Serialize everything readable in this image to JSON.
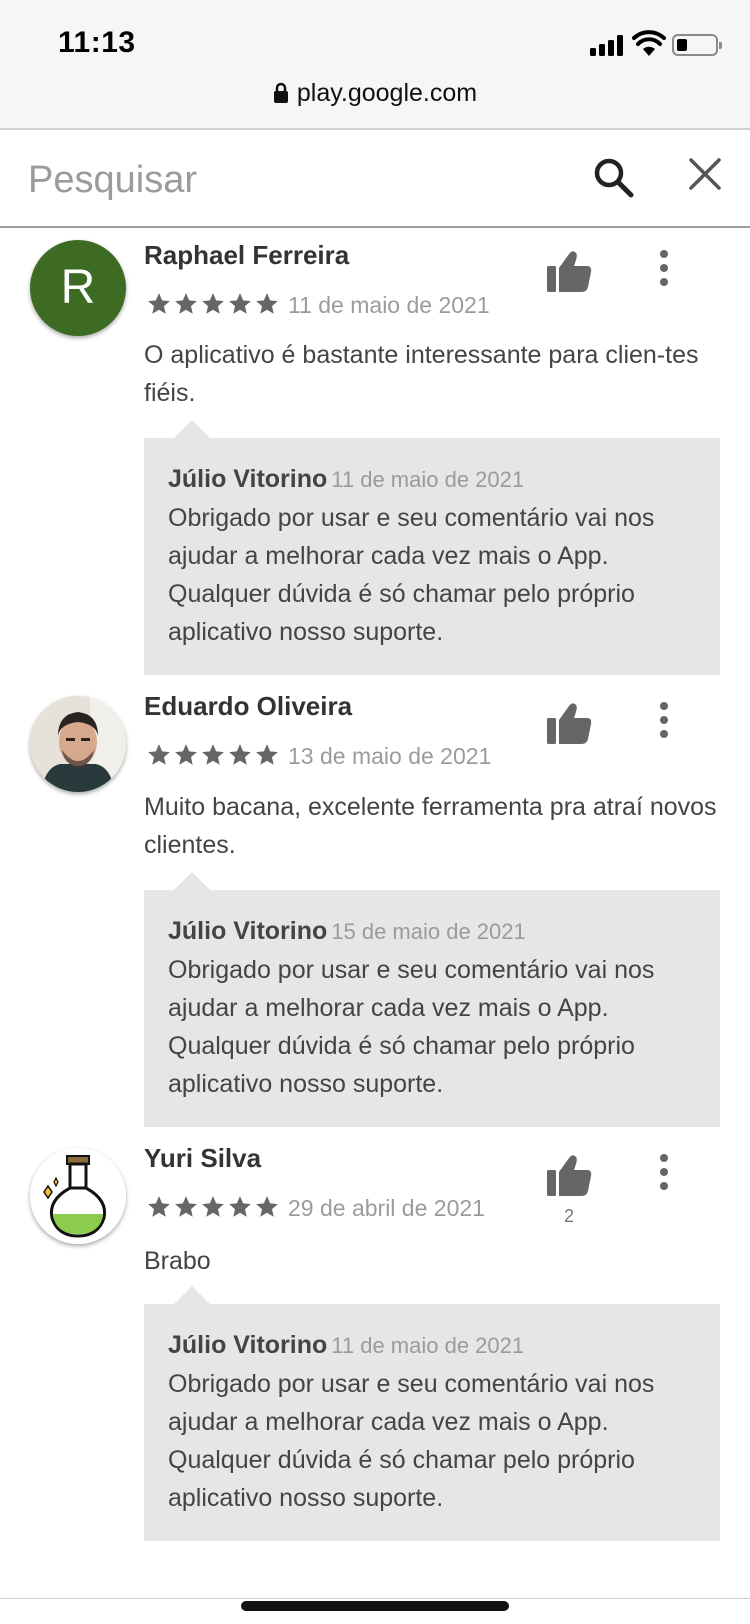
{
  "status_bar": {
    "time": "11:13",
    "url": "play.google.com"
  },
  "search": {
    "placeholder": "Pesquisar",
    "value": ""
  },
  "reviews": [
    {
      "author": "Raphael Ferreira",
      "avatar_letter": "R",
      "avatar_color": "#3e6b23",
      "rating": 5,
      "date": "11 de maio de 2021",
      "text": "O aplicativo é bastante interessante para clien-tes fiéis.",
      "likes": "",
      "reply": {
        "author": "Júlio Vitorino",
        "date": "11 de maio de 2021",
        "text": "Obrigado por usar e seu comentário vai nos ajudar a melhorar cada vez mais o App. Qualquer dúvida é só chamar pelo próprio aplicativo nosso suporte."
      }
    },
    {
      "author": "Eduardo Oliveira",
      "rating": 5,
      "date": "13 de maio de 2021",
      "text": "Muito bacana, excelente ferramenta pra atraí novos clientes.",
      "likes": "",
      "reply": {
        "author": "Júlio Vitorino",
        "date": "15 de maio de 2021",
        "text": "Obrigado por usar e seu comentário vai nos ajudar a melhorar cada vez mais o App. Qualquer dúvida é só chamar pelo próprio aplicativo nosso suporte."
      }
    },
    {
      "author": "Yuri Silva",
      "rating": 5,
      "date": "29 de abril de 2021",
      "text": "Brabo",
      "likes": "2",
      "reply": {
        "author": "Júlio Vitorino",
        "date": "11 de maio de 2021",
        "text": "Obrigado por usar e seu comentário vai nos ajudar a melhorar cada vez mais o App. Qualquer dúvida é só chamar pelo próprio aplicativo nosso suporte."
      }
    }
  ],
  "icons": {
    "search": "search-icon",
    "close": "close-icon",
    "like": "thumbs-up-icon",
    "more": "more-vert-icon",
    "star": "star-icon",
    "lock": "lock-icon"
  },
  "colors": {
    "star": "#666666",
    "reply_bg": "#e6e6e6",
    "secondary_text": "#9b9b9b"
  }
}
